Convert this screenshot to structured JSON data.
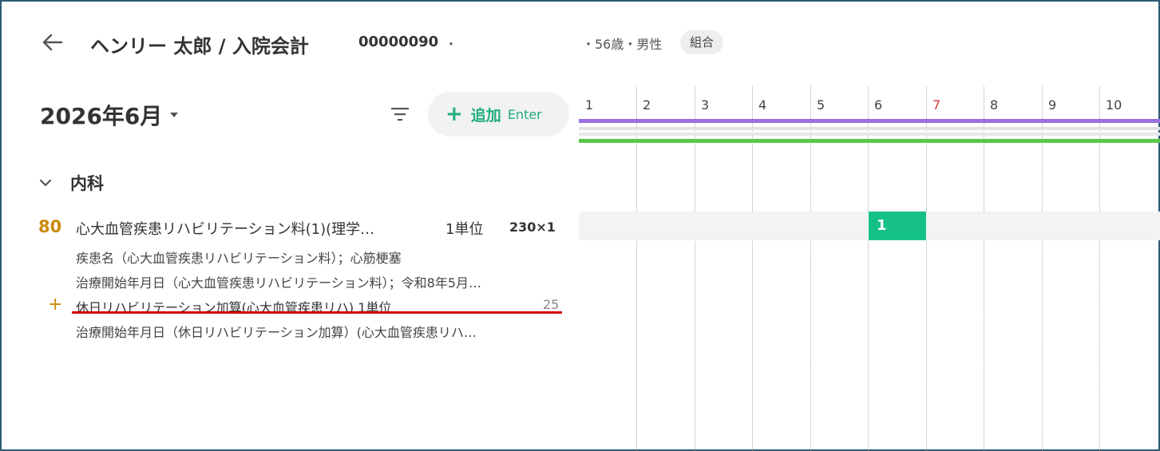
{
  "header": {
    "patient_name": "ヘンリー 太郎 / 入院会計",
    "patient_id": "00000090",
    "id_separator": "・",
    "patient_info": "・56歳・男性",
    "insurance_badge": "組合"
  },
  "toolbar": {
    "month_label": "2026年6月",
    "add_button_label": "追加",
    "add_button_shortcut": "Enter"
  },
  "department": {
    "label": "内科"
  },
  "order": {
    "number": "80",
    "name": "心大血管疾患リハビリテーション料(1)(理学…",
    "unit": "1単位",
    "points": "230×1",
    "details": [
      "疾患名（心大血管疾患リハビリテーション料）；心筋梗塞",
      "治療開始年月日（心大血管疾患リハビリテーション料）；令和8年5月…"
    ],
    "addon": {
      "name": "休日リハビリテーション加算(心大血管疾患リハ) 1単位",
      "points": "25",
      "detail": "治療開始年月日（休日リハビリテーション加算）(心大血管疾患リハ…"
    }
  },
  "calendar": {
    "days": [
      "1",
      "2",
      "3",
      "4",
      "5",
      "6",
      "7",
      "8",
      "9",
      "10"
    ],
    "sunday_day": "7",
    "cell_count": "1",
    "cell_day": "6"
  },
  "colors": {
    "accent_green": "#16c188",
    "order_number": "#c98a0b",
    "purple_bar": "#9b6fe0",
    "green_bar": "#5cc64c",
    "sunday_red": "#d23c3c",
    "highlight_red": "#d40000"
  },
  "icons": {
    "back": "arrow-left-icon",
    "month_dropdown": "caret-down-icon",
    "filter": "filter-icon",
    "add": "plus-icon",
    "department_toggle": "chevron-down-icon",
    "addon": "plus-icon"
  }
}
